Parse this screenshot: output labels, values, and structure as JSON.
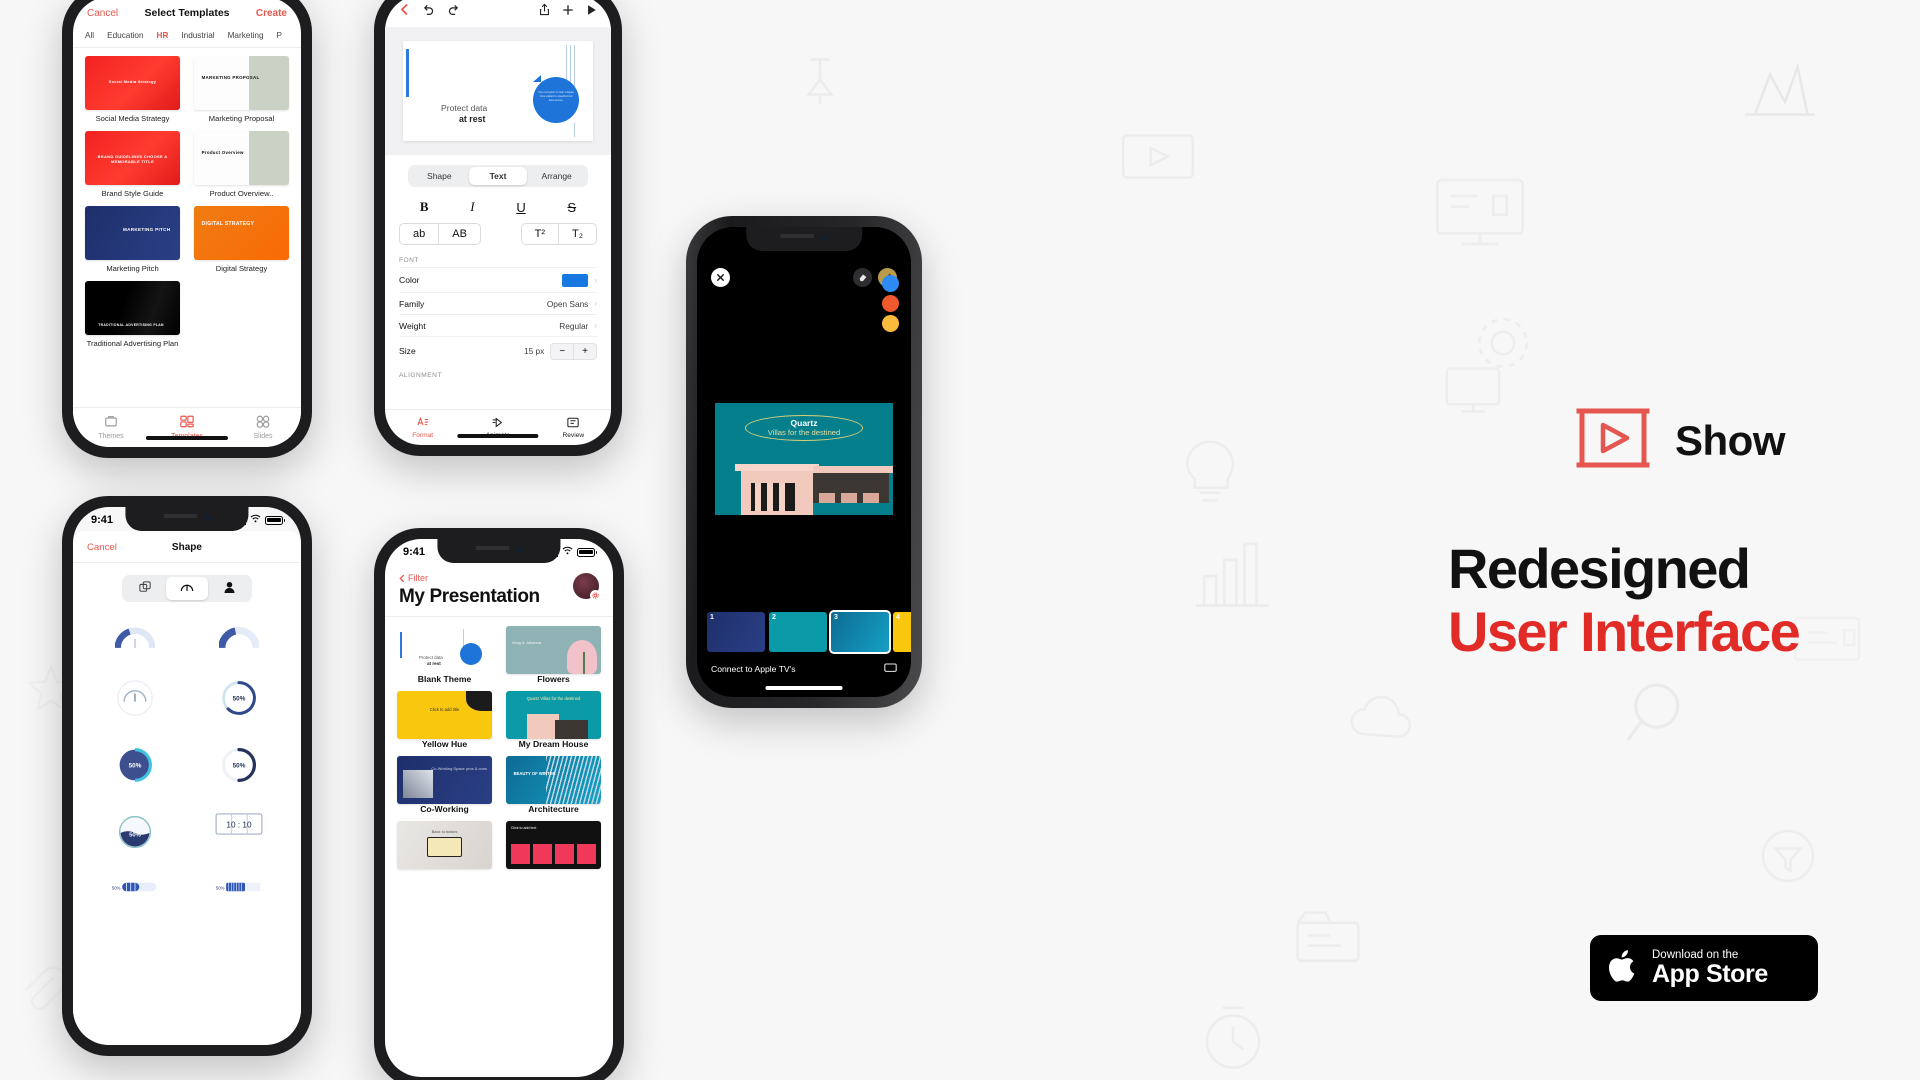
{
  "brand": {
    "logo_icon": "show-play-logo-icon",
    "name": "Show",
    "accent_red": "#e12b27",
    "ui_red": "#e8564d"
  },
  "headline": {
    "line1": "Redesigned",
    "line2": "User Interface"
  },
  "app_store": {
    "icon": "apple-logo-icon",
    "small_label": "Download on the",
    "big_label": "App Store"
  },
  "phone_templates": {
    "nav": {
      "cancel": "Cancel",
      "title": "Select Templates",
      "create": "Create"
    },
    "categories": [
      {
        "label": "All",
        "active": false
      },
      {
        "label": "Education",
        "active": false
      },
      {
        "label": "HR",
        "active": true
      },
      {
        "label": "Industrial",
        "active": false
      },
      {
        "label": "Marketing",
        "active": false
      },
      {
        "label": "P",
        "active": false
      }
    ],
    "templates": [
      {
        "name": "Social Media Strategy",
        "thumb_text": "Social Media Strategy",
        "style": "th-red"
      },
      {
        "name": "Marketing Proposal",
        "thumb_text": "MARKETING PROPOSAL",
        "style": "th-white"
      },
      {
        "name": "Brand Style Guide",
        "thumb_text": "BRAND GUIDELINES CHOOSE A MEMORABLE TITLE",
        "style": "th-red"
      },
      {
        "name": "Product Overview..",
        "thumb_text": "Product Overview",
        "style": "th-white"
      },
      {
        "name": "Marketing Pitch",
        "thumb_text": "MARKETING PITCH",
        "style": "th-navy"
      },
      {
        "name": "Digital Strategy",
        "thumb_text": "DIGITAL STRATEGY",
        "style": "th-orange"
      },
      {
        "name": "Traditional Advertising Plan",
        "thumb_text": "TRADITIONAL ADVERTISING PLAN",
        "style": "th-black"
      }
    ],
    "tabs": [
      {
        "label": "Themes",
        "icon": "themes-icon",
        "active": false
      },
      {
        "label": "Templates",
        "icon": "templates-grid-icon",
        "active": true
      },
      {
        "label": "Slides",
        "icon": "slides-icon",
        "active": false
      }
    ]
  },
  "phone_format": {
    "nav_left_icons": [
      "back-chevron-icon",
      "undo-icon",
      "redo-icon"
    ],
    "nav_right_icons": [
      "share-icon",
      "add-icon",
      "play-icon"
    ],
    "slide": {
      "title_line1": "Protect data",
      "title_line2": "at rest",
      "bubble_text": "Use encryption to help mitigate risks related to unauthorized data access."
    },
    "segments": [
      {
        "label": "Shape",
        "active": false
      },
      {
        "label": "Text",
        "active": true
      },
      {
        "label": "Arrange",
        "active": false
      }
    ],
    "styles": [
      {
        "label": "B",
        "name": "bold-button"
      },
      {
        "label": "I",
        "name": "italic-button"
      },
      {
        "label": "U",
        "name": "underline-button"
      },
      {
        "label": "S",
        "name": "strikethrough-button"
      }
    ],
    "case_left": [
      "ab",
      "AB"
    ],
    "case_right": [
      "T²",
      "T₂"
    ],
    "font_section_label": "FONT",
    "font_rows": [
      {
        "label": "Color",
        "value": "",
        "swatch": "#1779e0"
      },
      {
        "label": "Family",
        "value": "Open Sans",
        "swatch": ""
      },
      {
        "label": "Weight",
        "value": "Regular",
        "swatch": ""
      }
    ],
    "size_row": {
      "label": "Size",
      "value": "15 px",
      "minus": "−",
      "plus": "+"
    },
    "alignment_label": "ALIGNMENT",
    "toolbar": [
      {
        "label": "Format",
        "icon": "format-text-icon",
        "active": true
      },
      {
        "label": "Animate",
        "icon": "animate-icon",
        "active": false
      },
      {
        "label": "Review",
        "icon": "review-icon",
        "active": false
      }
    ]
  },
  "phone_presenter": {
    "close_icon": "close-icon",
    "eraser_icon": "eraser-icon",
    "pen_icon": "pen-icon",
    "pen_colors": [
      "#2e8bf5",
      "#f0592b",
      "#f8bb3d"
    ],
    "slide": {
      "title": "Quartz",
      "subtitle": "Villas for the destined"
    },
    "filmstrip": [
      {
        "number": "1",
        "style": "th-navy"
      },
      {
        "number": "2",
        "style": "th-cyan"
      },
      {
        "number": "3",
        "style": "th-bluegrad",
        "selected": true
      },
      {
        "number": "4",
        "style": "th-yellow"
      }
    ],
    "connect_label": "Connect to Apple TV's",
    "airplay_icon": "airplay-icon"
  },
  "phone_shape": {
    "status_time": "9:41",
    "nav": {
      "cancel": "Cancel",
      "title": "Shape"
    },
    "segments": [
      {
        "icon": "shapes-icon",
        "active": false
      },
      {
        "icon": "gauge-icon",
        "active": true
      },
      {
        "icon": "person-icon",
        "active": false
      }
    ],
    "shapes": [
      {
        "name": "quarter-gauge-filled",
        "value": "50%"
      },
      {
        "name": "quarter-gauge-thick",
        "value": "50%"
      },
      {
        "name": "half-gauge-needle",
        "value": ""
      },
      {
        "name": "ring-progress-open",
        "value": "50%"
      },
      {
        "name": "donut-solid-fill",
        "value": "50%"
      },
      {
        "name": "ring-progress-dark",
        "value": "50%"
      },
      {
        "name": "liquid-fill-circle",
        "value": "50%"
      },
      {
        "name": "digit-counter",
        "value": "10 : 10"
      },
      {
        "name": "bar-progress-blocks",
        "value": "50%"
      },
      {
        "name": "bar-progress-striped",
        "value": "50%"
      }
    ]
  },
  "phone_presentations": {
    "status_time": "9:41",
    "filter_label": "Filter",
    "title": "My Presentation",
    "avatar_badge_icon": "gear-icon",
    "items": [
      {
        "name": "Blank Theme",
        "style": "th-blank",
        "thumb_text": "Protect data at rest"
      },
      {
        "name": "Flowers",
        "style": "th-teal",
        "thumb_text": "Greg & Johanna"
      },
      {
        "name": "Yellow Hue",
        "style": "th-yellow",
        "thumb_text": "Click to add title"
      },
      {
        "name": "My Dream House",
        "style": "th-cyan",
        "thumb_text": "Quartz Villas for the destined"
      },
      {
        "name": "Co-Working",
        "style": "th-navy",
        "thumb_text": "Co-Working Space pros & cons"
      },
      {
        "name": "Architecture",
        "style": "th-bluegrad",
        "thumb_text": "BEAUTY OF WINTER"
      },
      {
        "name": "",
        "style": "th-gray",
        "thumb_text": "Back to basics"
      },
      {
        "name": "",
        "style": "th-darkred",
        "thumb_text": "Click to add text"
      }
    ]
  }
}
